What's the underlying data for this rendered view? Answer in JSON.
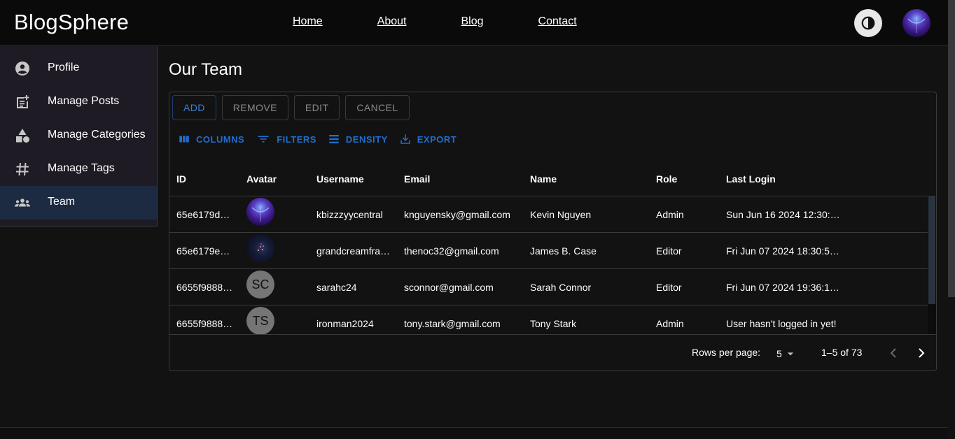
{
  "app": {
    "brand": "BlogSphere",
    "nav": [
      "Home",
      "About",
      "Blog",
      "Contact"
    ]
  },
  "header": {
    "theme_toggle_icon": "contrast-icon",
    "avatar_icon": "user-avatar-image"
  },
  "sidebar": {
    "items": [
      {
        "label": "Profile",
        "icon": "account-circle-icon",
        "active": false
      },
      {
        "label": "Manage Posts",
        "icon": "post-add-icon",
        "active": false
      },
      {
        "label": "Manage Categories",
        "icon": "category-icon",
        "active": false
      },
      {
        "label": "Manage Tags",
        "icon": "tag-icon",
        "active": false
      },
      {
        "label": "Team",
        "icon": "groups-icon",
        "active": true
      }
    ]
  },
  "main": {
    "title": "Our Team",
    "actions": [
      "ADD",
      "REMOVE",
      "EDIT",
      "CANCEL"
    ],
    "toolbar": [
      "COLUMNS",
      "FILTERS",
      "DENSITY",
      "EXPORT"
    ],
    "columns": [
      "ID",
      "Avatar",
      "Username",
      "Email",
      "Name",
      "Role",
      "Last Login"
    ],
    "rows": [
      {
        "id": "65e6179d…",
        "avatar": "",
        "username": "kbizzzyycentral",
        "email": "knguyensky@gmail.com",
        "name": "Kevin Nguyen",
        "role": "Admin",
        "last_login": "Sun Jun 16 2024 12:30:…"
      },
      {
        "id": "65e6179e…",
        "avatar": "",
        "username": "grandcreamfra…",
        "email": "thenoc32@gmail.com",
        "name": "James B. Case",
        "role": "Editor",
        "last_login": "Fri Jun 07 2024 18:30:5…"
      },
      {
        "id": "6655f9888…",
        "avatar": "SC",
        "username": "sarahc24",
        "email": "sconnor@gmail.com",
        "name": "Sarah Connor",
        "role": "Editor",
        "last_login": "Fri Jun 07 2024 19:36:1…"
      },
      {
        "id": "6655f9888…",
        "avatar": "TS",
        "username": "ironman2024",
        "email": "tony.stark@gmail.com",
        "name": "Tony Stark",
        "role": "Admin",
        "last_login": "User hasn't logged in yet!"
      }
    ],
    "pagination": {
      "rows_per_page_label": "Rows per page:",
      "rows_per_page": "5",
      "range": "1–5 of 73"
    }
  },
  "colors": {
    "accent": "#1f6fd1",
    "background": "#121212",
    "sidebar": "#1e1b24",
    "active_item": "#1c2a42"
  }
}
